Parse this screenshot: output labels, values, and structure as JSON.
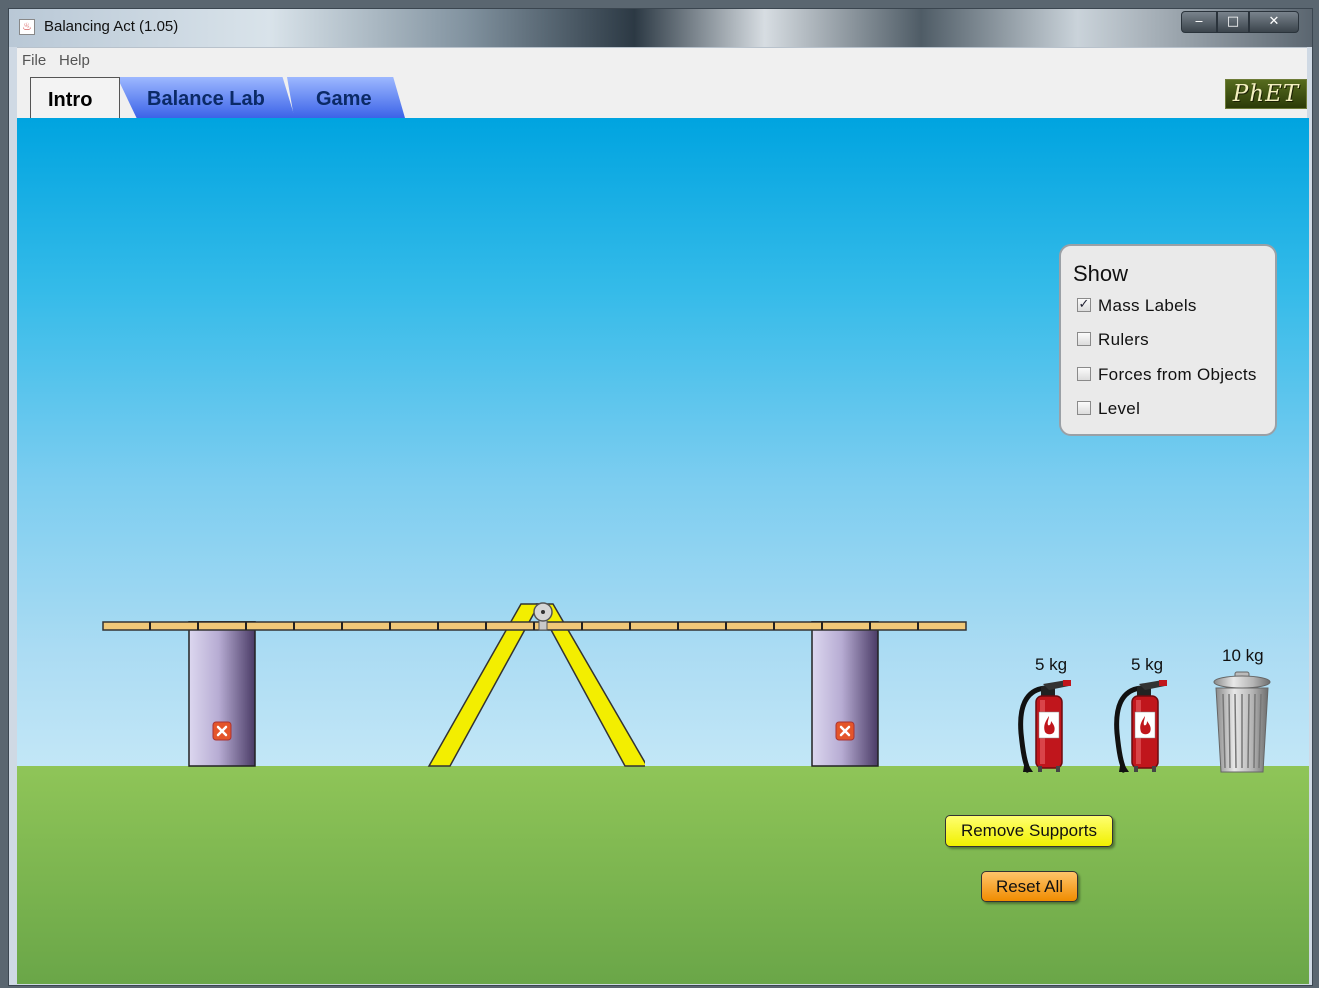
{
  "window": {
    "title": "Balancing Act (1.05)",
    "controls": {
      "minimize": "‒",
      "maximize": "□",
      "close": "✕"
    }
  },
  "menu": {
    "items": [
      "File",
      "Help"
    ]
  },
  "tabs": [
    {
      "label": "Intro",
      "selected": true
    },
    {
      "label": "Balance Lab",
      "selected": false
    },
    {
      "label": "Game",
      "selected": false
    }
  ],
  "logo": {
    "text": "PhET"
  },
  "show_panel": {
    "title": "Show",
    "options": [
      {
        "label": "Mass Labels",
        "checked": true
      },
      {
        "label": "Rulers",
        "checked": false
      },
      {
        "label": "Forces from Objects",
        "checked": false
      },
      {
        "label": "Level",
        "checked": false
      }
    ]
  },
  "masses": [
    {
      "label": "5 kg",
      "icon": "fire-extinguisher-icon"
    },
    {
      "label": "5 kg",
      "icon": "fire-extinguisher-icon"
    },
    {
      "label": "10 kg",
      "icon": "trash-can-icon"
    }
  ],
  "buttons": {
    "remove_supports": "Remove Supports",
    "reset_all": "Reset All"
  },
  "colors": {
    "sky": "#00a4e0",
    "ground": "#8fc558",
    "plank": "#f0c878",
    "fulcrum": "#f0f000",
    "support": "#c4bde0",
    "extinguisher": "#c0161c"
  }
}
